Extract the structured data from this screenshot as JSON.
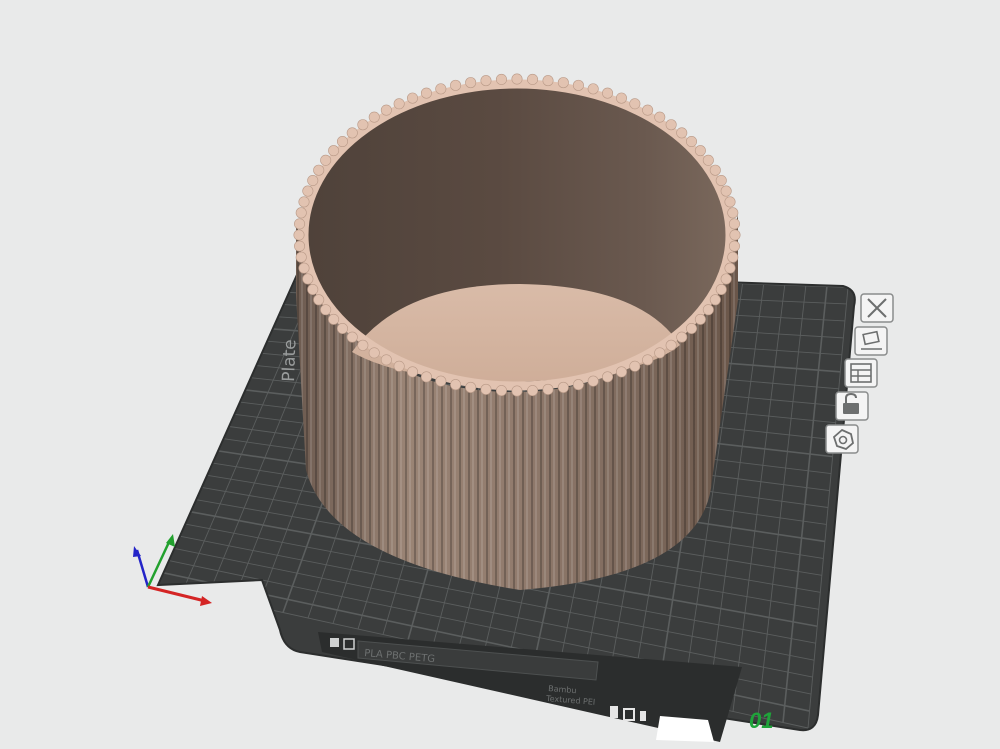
{
  "plate": {
    "side_label": "Plate",
    "filament_label": "PLA PBC PETG",
    "sticker_label_1": "Bambu",
    "sticker_label_2": "Textured PEI",
    "plate_number": "01"
  },
  "toolbar": {
    "buttons": [
      {
        "name": "close",
        "icon": "close-icon"
      },
      {
        "name": "auto-orient",
        "icon": "orient-icon"
      },
      {
        "name": "arrange",
        "icon": "arrange-icon"
      },
      {
        "name": "lock",
        "icon": "lock-icon"
      },
      {
        "name": "settings",
        "icon": "gear-icon"
      }
    ]
  },
  "colors": {
    "background": "#e9eaea",
    "plate": "#3b3d3d",
    "grid": "#5b5e5e",
    "model_outer": "#8a7466",
    "model_inner": "#5d4d44",
    "model_floor": "#d4b6a3",
    "rim": "#e2c3b1",
    "plate_number": "#1fa33a",
    "axis_x": "#d42424",
    "axis_y": "#22a12e",
    "axis_z": "#2424c8"
  }
}
